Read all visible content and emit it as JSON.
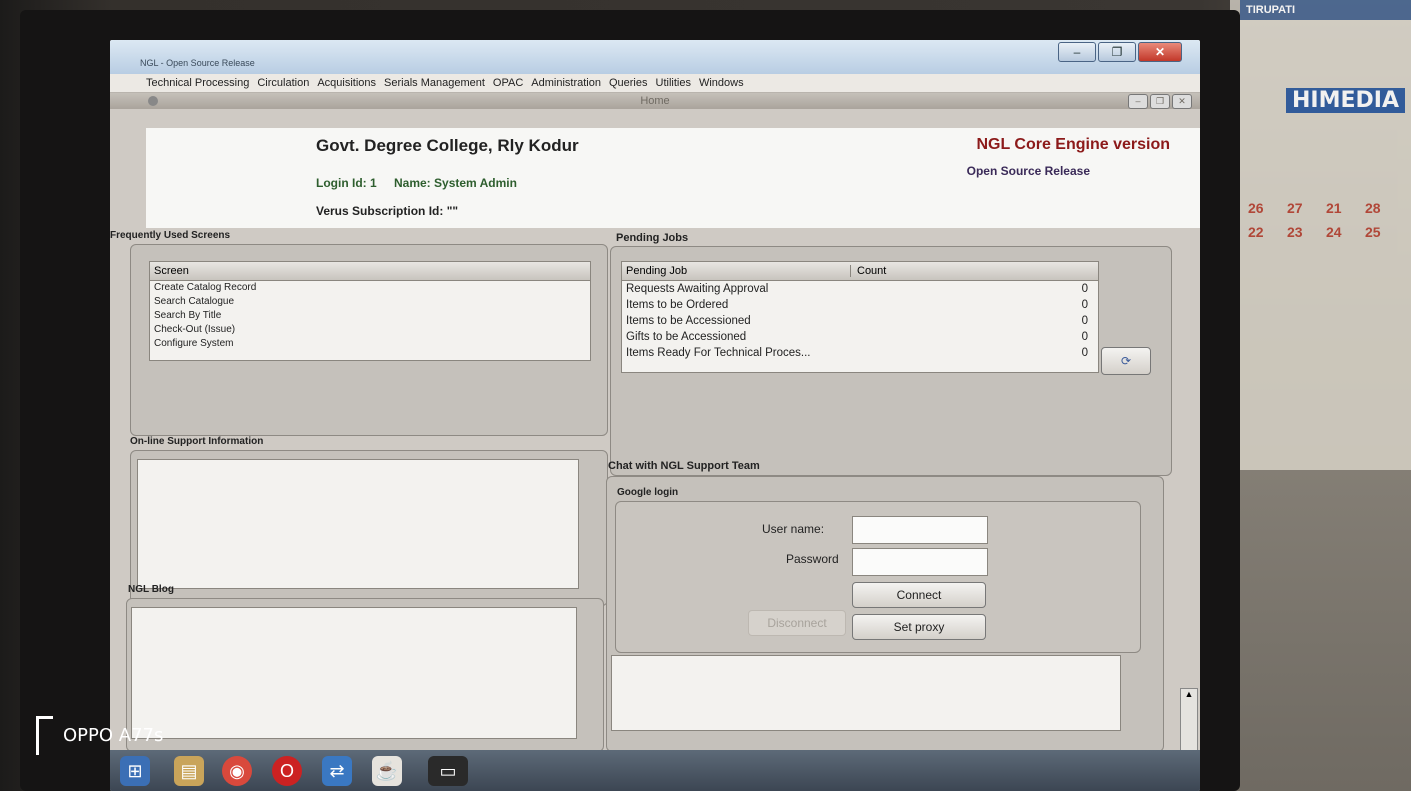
{
  "window": {
    "title": "NGL - Open Source Release"
  },
  "menu": [
    "Technical Processing",
    "Circulation",
    "Acquisitions",
    "Serials Management",
    "OPAC",
    "Administration",
    "Queries",
    "Utilities",
    "Windows"
  ],
  "internal": {
    "title": "Home"
  },
  "header": {
    "college": "Govt. Degree College, Rly Kodur",
    "login_id": "Login Id: 1",
    "name": "Name: System Admin",
    "verus": "Verus Subscription Id: \"\"",
    "engine": "NGL Core Engine version",
    "release": "Open Source Release"
  },
  "frequent": {
    "title": "Frequently Used Screens",
    "column": "Screen",
    "items": [
      "Create Catalog Record",
      "Search Catalogue",
      "Search By Title",
      "Check-Out (Issue)",
      "Configure System"
    ]
  },
  "pending": {
    "title": "Pending Jobs",
    "col_job": "Pending Job",
    "col_count": "Count",
    "rows": [
      {
        "job": "Requests Awaiting Approval",
        "count": "0"
      },
      {
        "job": "Items to be Ordered",
        "count": "0"
      },
      {
        "job": "Items to be Accessioned",
        "count": "0"
      },
      {
        "job": "Gifts to be Accessioned",
        "count": "0"
      },
      {
        "job": "Items Ready For Technical Proces...",
        "count": "0"
      }
    ]
  },
  "online": {
    "title": "On-line Support Information"
  },
  "blog": {
    "title": "NGL Blog"
  },
  "chat": {
    "title": "Chat with NGL Support Team",
    "google": "Google login",
    "username_label": "User name:",
    "password_label": "Password",
    "connect": "Connect",
    "disconnect": "Disconnect",
    "proxy": "Set proxy"
  },
  "watermark": "OPPO A77s",
  "calendar": {
    "header": "TIRUPATI",
    "brand": "HIMEDIA",
    "days": [
      "26",
      "27",
      "21",
      "28",
      "22",
      "23",
      "24",
      "25"
    ]
  }
}
